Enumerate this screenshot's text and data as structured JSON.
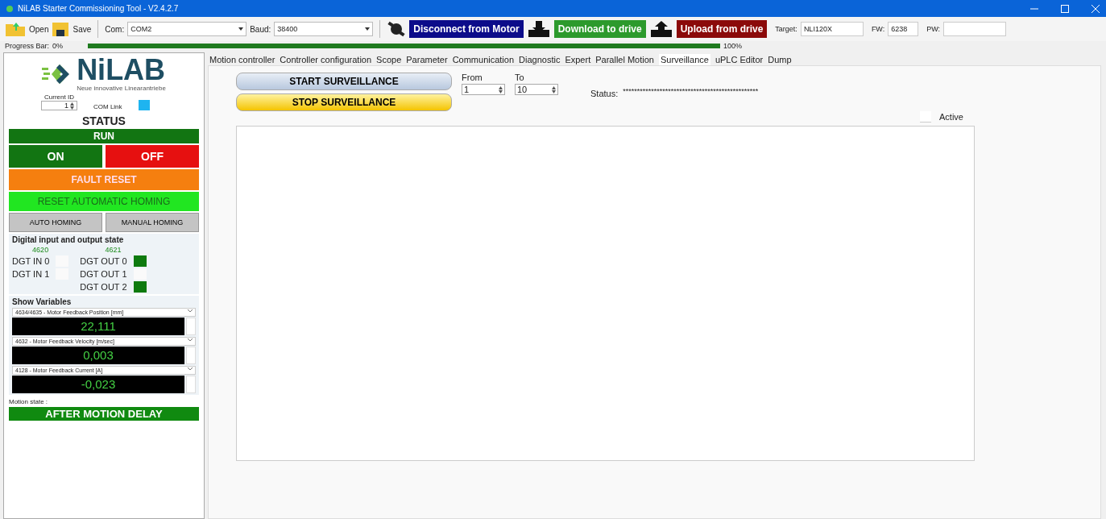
{
  "window": {
    "title": "NiLAB Starter Commissioning Tool - V2.4.2.7"
  },
  "toolbar": {
    "open": "Open",
    "save": "Save",
    "com_label": "Com:",
    "com_value": "COM2",
    "baud_label": "Baud:",
    "baud_value": "38400",
    "disconnect": "Disconnect from Motor",
    "download": "Download to drive",
    "upload": "Upload from drive",
    "target_label": "Target:",
    "target_value": "NLI120X",
    "fw_label": "FW:",
    "fw_value": "6238",
    "pw_label": "PW:"
  },
  "progress": {
    "label": "Progress Bar:",
    "start": "0%",
    "level": 1,
    "end": "100%"
  },
  "sidebar": {
    "logo": "NiLAB",
    "tagline": "Neue innovative Linearantriebe",
    "current_id_label": "Current ID",
    "current_id": "1",
    "com_link_label": "COM Link",
    "com_link_on": true,
    "status_title": "STATUS",
    "status": "RUN",
    "on": "ON",
    "off": "OFF",
    "fault_reset": "FAULT RESET",
    "reset_homing": "RESET AUTOMATIC HOMING",
    "auto_homing": "AUTO HOMING",
    "manual_homing": "MANUAL HOMING",
    "io_title": "Digital input and output state",
    "inputs_code": "4620",
    "outputs_code": "4621",
    "inputs": [
      {
        "label": "DGT IN 0",
        "on": false
      },
      {
        "label": "DGT IN 1",
        "on": false
      }
    ],
    "outputs": [
      {
        "label": "DGT OUT 0",
        "on": true
      },
      {
        "label": "DGT OUT 1",
        "on": false
      },
      {
        "label": "DGT OUT 2",
        "on": true
      }
    ],
    "variables_title": "Show Variables",
    "variables": [
      {
        "name": "4634/4635 - Motor Feedback Position [mm]",
        "value": "22,111"
      },
      {
        "name": "4632 - Motor Feedback Velocity [m/sec]",
        "value": "0,003"
      },
      {
        "name": "4128 - Motor Feedback Current [A]",
        "value": "-0,023"
      }
    ],
    "motion_state_label": "Motion state :",
    "motion_state": "AFTER MOTION DELAY"
  },
  "tabs": [
    {
      "label": "Motion controller",
      "selected": false
    },
    {
      "label": "Controller configuration",
      "selected": false
    },
    {
      "label": "Scope",
      "selected": false
    },
    {
      "label": "Parameter",
      "selected": false
    },
    {
      "label": "Communication",
      "selected": false
    },
    {
      "label": "Diagnostic",
      "selected": false
    },
    {
      "label": "Expert",
      "selected": false
    },
    {
      "label": "Parallel Motion",
      "selected": false
    },
    {
      "label": "Surveillance",
      "selected": true
    },
    {
      "label": "uPLC Editor",
      "selected": false
    },
    {
      "label": "Dump",
      "selected": false
    }
  ],
  "surveillance": {
    "start": "START SURVEILLANCE",
    "stop": "STOP SURVEILLANCE",
    "from_label": "From",
    "from_value": "1",
    "to_label": "To",
    "to_value": "10",
    "status_label": "Status:",
    "status_value": "************************************************",
    "active_label": "Active",
    "active": false
  }
}
